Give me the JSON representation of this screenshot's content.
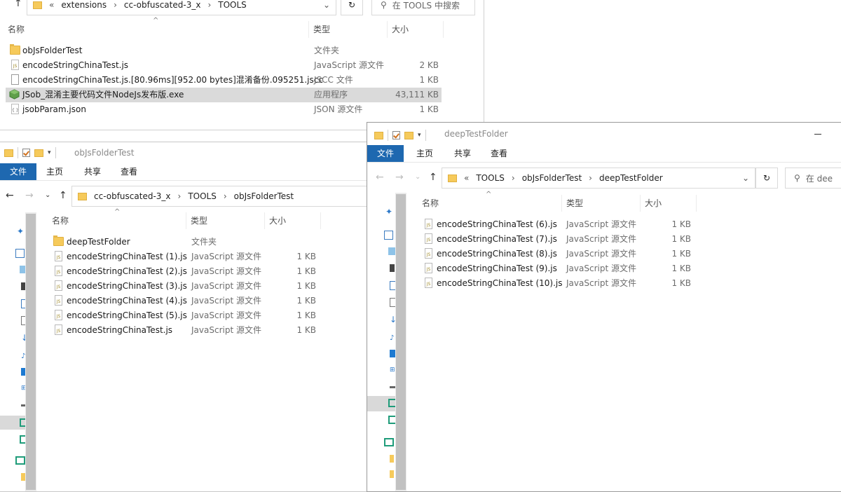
{
  "window1": {
    "breadcrumb": [
      "«",
      "extensions",
      "cc-obfuscated-3_x",
      "TOOLS"
    ],
    "search_placeholder": "在 TOOLS 中搜索",
    "columns": {
      "name": "名称",
      "type": "类型",
      "size": "大小"
    },
    "rows": [
      {
        "icon": "folder-icon",
        "name": "obJsFolderTest",
        "type": "文件夹",
        "size": ""
      },
      {
        "icon": "js-file-icon",
        "name": "encodeStringChinaTest.js",
        "type": "JavaScript 源文件",
        "size": "2 KB"
      },
      {
        "icon": "file-icon",
        "name": "encodeStringChinaTest.js.[80.96ms][952.00 bytes]混淆备份.095251.jscc",
        "type": "JSCC 文件",
        "size": "1 KB"
      },
      {
        "icon": "exe-icon",
        "name": "JSob_混淆主要代码文件NodeJs发布版.exe",
        "type": "应用程序",
        "size": "43,111 KB",
        "selected": true
      },
      {
        "icon": "json-file-icon",
        "name": "jsobParam.json",
        "type": "JSON 源文件",
        "size": "1 KB"
      }
    ]
  },
  "window2": {
    "title": "obJsFolderTest",
    "ribbon": {
      "file": "文件",
      "home": "主页",
      "share": "共享",
      "view": "查看"
    },
    "breadcrumb": [
      "cc-obfuscated-3_x",
      "TOOLS",
      "obJsFolderTest"
    ],
    "columns": {
      "name": "名称",
      "type": "类型",
      "size": "大小"
    },
    "rows": [
      {
        "icon": "folder-icon",
        "name": "deepTestFolder",
        "type": "文件夹",
        "size": ""
      },
      {
        "icon": "js-file-icon",
        "name": "encodeStringChinaTest (1).js",
        "type": "JavaScript 源文件",
        "size": "1 KB"
      },
      {
        "icon": "js-file-icon",
        "name": "encodeStringChinaTest (2).js",
        "type": "JavaScript 源文件",
        "size": "1 KB"
      },
      {
        "icon": "js-file-icon",
        "name": "encodeStringChinaTest (3).js",
        "type": "JavaScript 源文件",
        "size": "1 KB"
      },
      {
        "icon": "js-file-icon",
        "name": "encodeStringChinaTest (4).js",
        "type": "JavaScript 源文件",
        "size": "1 KB"
      },
      {
        "icon": "js-file-icon",
        "name": "encodeStringChinaTest (5).js",
        "type": "JavaScript 源文件",
        "size": "1 KB"
      },
      {
        "icon": "js-file-icon",
        "name": "encodeStringChinaTest.js",
        "type": "JavaScript 源文件",
        "size": "1 KB"
      }
    ]
  },
  "window3": {
    "title": "deepTestFolder",
    "ribbon": {
      "file": "文件",
      "home": "主页",
      "share": "共享",
      "view": "查看"
    },
    "breadcrumb": [
      "«",
      "TOOLS",
      "obJsFolderTest",
      "deepTestFolder"
    ],
    "search_placeholder": "在 dee",
    "columns": {
      "name": "名称",
      "type": "类型",
      "size": "大小"
    },
    "rows": [
      {
        "icon": "js-file-icon",
        "name": "encodeStringChinaTest (6).js",
        "type": "JavaScript 源文件",
        "size": "1 KB"
      },
      {
        "icon": "js-file-icon",
        "name": "encodeStringChinaTest (7).js",
        "type": "JavaScript 源文件",
        "size": "1 KB"
      },
      {
        "icon": "js-file-icon",
        "name": "encodeStringChinaTest (8).js",
        "type": "JavaScript 源文件",
        "size": "1 KB"
      },
      {
        "icon": "js-file-icon",
        "name": "encodeStringChinaTest (9).js",
        "type": "JavaScript 源文件",
        "size": "1 KB"
      },
      {
        "icon": "js-file-icon",
        "name": "encodeStringChinaTest (10).js",
        "type": "JavaScript 源文件",
        "size": "1 KB"
      }
    ]
  },
  "colors": {
    "ribbon_file": "#1e68b0",
    "selection": "#dadada",
    "folder": "#f6ca5b"
  }
}
